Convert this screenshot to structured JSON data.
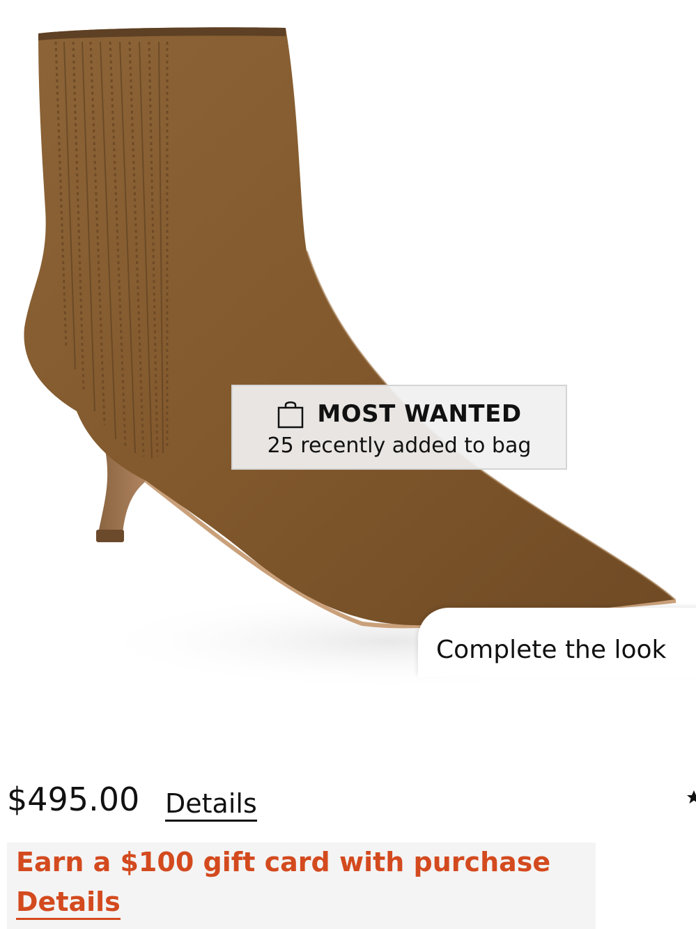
{
  "product": {
    "image_alt": "brown suede pointed-toe kitten heel ankle boot"
  },
  "badge": {
    "icon": "shopping-bag-icon",
    "title": "MOST WANTED",
    "subtitle": "25 recently added to bag"
  },
  "complete_look": {
    "label": "Complete the look"
  },
  "pricing": {
    "price": "$495.00",
    "details_label": "Details"
  },
  "rating": {
    "icon": "star-icon"
  },
  "promo": {
    "text": "Earn a $100 gift card with purchase",
    "details_label": "Details",
    "color": "#d34a1e"
  }
}
